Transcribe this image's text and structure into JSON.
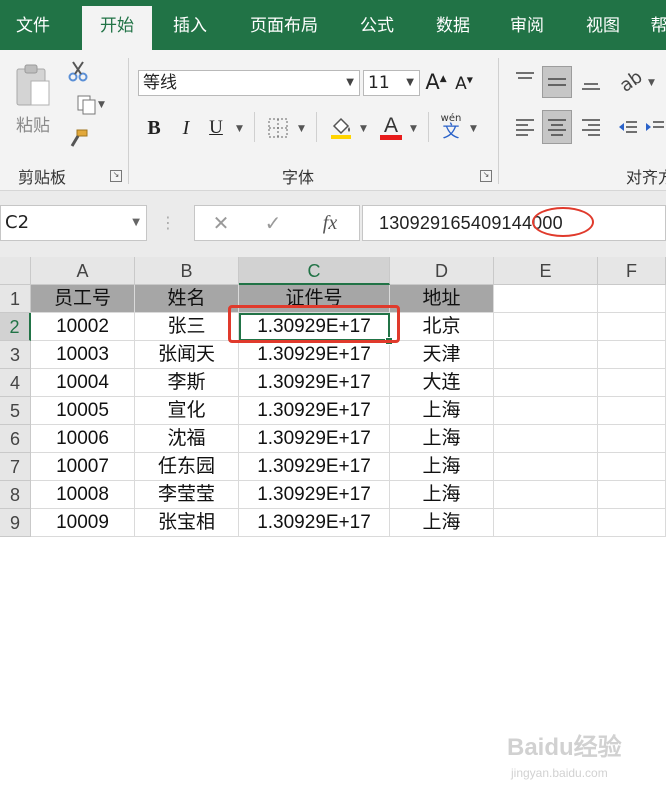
{
  "tabs": [
    {
      "label": "文件",
      "active": false
    },
    {
      "label": "开始",
      "active": true
    },
    {
      "label": "插入",
      "active": false
    },
    {
      "label": "页面布局",
      "active": false
    },
    {
      "label": "公式",
      "active": false
    },
    {
      "label": "数据",
      "active": false
    },
    {
      "label": "审阅",
      "active": false
    },
    {
      "label": "视图",
      "active": false
    },
    {
      "label": "帮",
      "active": false
    }
  ],
  "ribbon": {
    "clipboard": {
      "label": "剪贴板",
      "paste_label": "粘贴"
    },
    "font": {
      "label": "字体",
      "font_name": "等线",
      "font_size": "11",
      "phonetic_top": "wén",
      "phonetic_char": "文"
    },
    "alignment": {
      "label": "对齐方"
    }
  },
  "formula_bar": {
    "name_box": "C2",
    "cancel_symbol": "✕",
    "enter_symbol": "✓",
    "fx_symbol": "fx",
    "content": "130929165409144000"
  },
  "sheet": {
    "columns": [
      "A",
      "B",
      "C",
      "D",
      "E",
      "F"
    ],
    "selected_column": "C",
    "rows": [
      "1",
      "2",
      "3",
      "4",
      "5",
      "6",
      "7",
      "8",
      "9"
    ],
    "selected_row": "2",
    "headers": [
      "员工号",
      "姓名",
      "证件号",
      "地址"
    ],
    "records": [
      [
        "10002",
        "张三",
        "1.30929E+17",
        "北京"
      ],
      [
        "10003",
        "张闻天",
        "1.30929E+17",
        "天津"
      ],
      [
        "10004",
        "李斯",
        "1.30929E+17",
        "大连"
      ],
      [
        "10005",
        "宣化",
        "1.30929E+17",
        "上海"
      ],
      [
        "10006",
        "沈福",
        "1.30929E+17",
        "上海"
      ],
      [
        "10007",
        "任东园",
        "1.30929E+17",
        "上海"
      ],
      [
        "10008",
        "李莹莹",
        "1.30929E+17",
        "上海"
      ],
      [
        "10009",
        "张宝相",
        "1.30929E+17",
        "上海"
      ]
    ]
  },
  "watermark": {
    "text": "Baidu经验",
    "sub": "jingyan.baidu.com"
  },
  "colors": {
    "accent": "#217346",
    "annotation": "#e03a2c",
    "header_fill": "#a6a6a6"
  }
}
